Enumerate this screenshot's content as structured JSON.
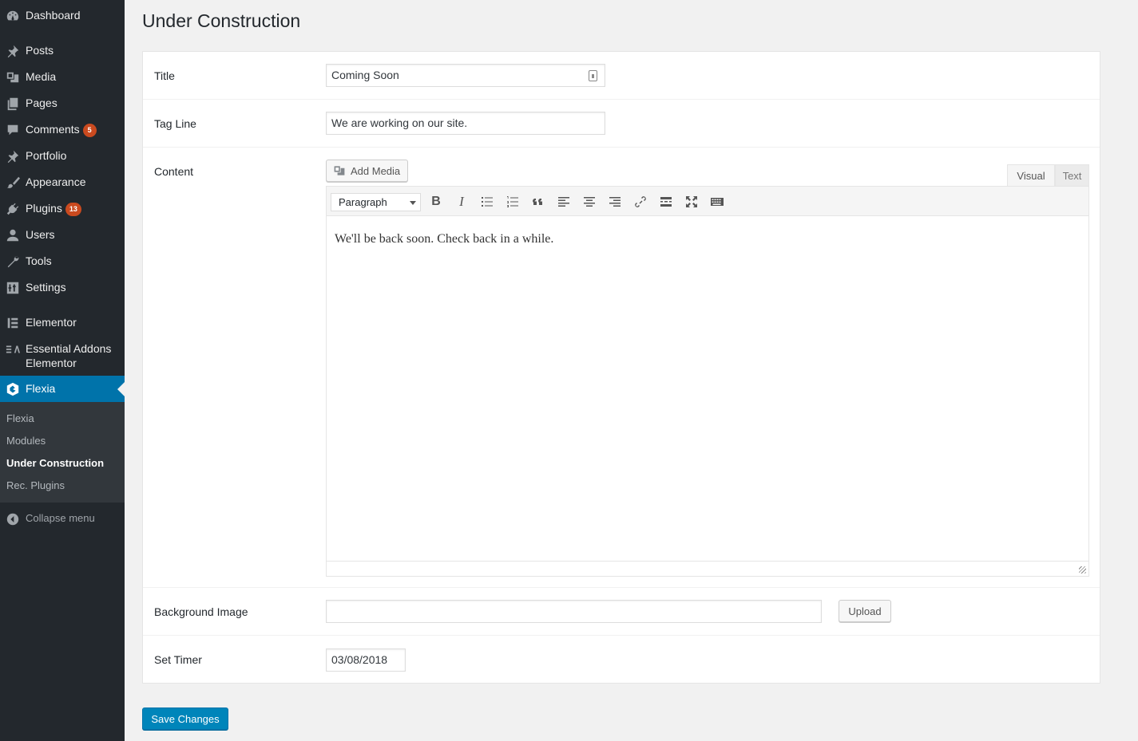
{
  "sidebar": {
    "items": [
      {
        "label": "Dashboard",
        "icon": "dashboard-icon"
      },
      {
        "label": "Posts",
        "icon": "pin-icon"
      },
      {
        "label": "Media",
        "icon": "media-icon"
      },
      {
        "label": "Pages",
        "icon": "pages-icon"
      },
      {
        "label": "Comments",
        "icon": "comment-icon",
        "badge": "5"
      },
      {
        "label": "Portfolio",
        "icon": "pin-icon"
      },
      {
        "label": "Appearance",
        "icon": "brush-icon"
      },
      {
        "label": "Plugins",
        "icon": "plugin-icon",
        "badge": "13"
      },
      {
        "label": "Users",
        "icon": "user-icon"
      },
      {
        "label": "Tools",
        "icon": "wrench-icon"
      },
      {
        "label": "Settings",
        "icon": "settings-icon"
      },
      {
        "label": "Elementor",
        "icon": "elementor-icon"
      },
      {
        "label": "Essential Addons Elementor",
        "icon": "essential-addons-icon"
      },
      {
        "label": "Flexia",
        "icon": "flexia-icon"
      }
    ],
    "submenu": [
      "Flexia",
      "Modules",
      "Under Construction",
      "Rec. Plugins"
    ],
    "collapse_label": "Collapse menu"
  },
  "page": {
    "title": "Under Construction",
    "save_label": "Save Changes"
  },
  "form": {
    "title_label": "Title",
    "title_value": "Coming Soon",
    "tagline_label": "Tag Line",
    "tagline_value": "We are working on our site.",
    "content_label": "Content",
    "add_media_label": "Add Media",
    "tab_visual": "Visual",
    "tab_text": "Text",
    "format_selected": "Paragraph",
    "editor_content": "We'll be back soon. Check back in a while.",
    "bg_label": "Background Image",
    "bg_value": "",
    "upload_label": "Upload",
    "timer_label": "Set Timer",
    "timer_value": "03/08/2018"
  },
  "colors": {
    "sidebar_bg": "#23282d",
    "accent": "#0073aa",
    "badge": "#ca4a1f",
    "primary_button": "#0085ba"
  }
}
